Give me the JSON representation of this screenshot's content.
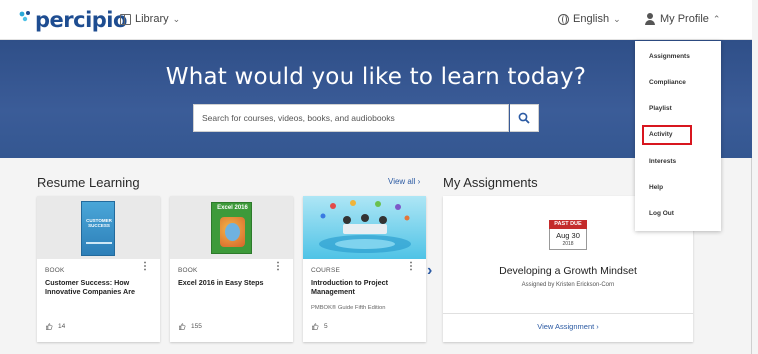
{
  "nav": {
    "logo_text": "percipio",
    "library_label": "Library",
    "language_label": "English",
    "profile_label": "My Profile",
    "chevron_down": "⌄",
    "chevron_up": "⌃"
  },
  "hero": {
    "title": "What would you like to learn today?",
    "search_placeholder": "Search for courses, videos, books, and audiobooks"
  },
  "resume": {
    "title": "Resume Learning",
    "view_all": "View all  ›",
    "cards": [
      {
        "type": "BOOK",
        "title": "Customer Success: How Innovative Companies Are",
        "subtitle": "",
        "likes": "14",
        "cover_text": "CUSTOMER SUCCESS"
      },
      {
        "type": "BOOK",
        "title": "Excel 2016 in Easy Steps",
        "subtitle": "",
        "likes": "155",
        "cover_text": "Excel 2016"
      },
      {
        "type": "COURSE",
        "title": "Introduction to Project Management",
        "subtitle": "PMBOK® Guide Fifth Edition",
        "likes": "5",
        "cover_text": ""
      }
    ],
    "next_arrow": "›"
  },
  "assignments": {
    "title": "My Assignments",
    "badge": "PAST DUE",
    "due_date": "Aug 30",
    "due_year": "2018",
    "item_title": "Developing a Growth Mindset",
    "assigned_by": "Assigned by Kristen Erickson-Corn",
    "link": "View Assignment  ›"
  },
  "profile_menu": {
    "items": [
      "Assignments",
      "Compliance",
      "Playlist",
      "Activity",
      "Interests",
      "Help",
      "Log Out"
    ],
    "highlighted": "Activity",
    "highlight_color": "#d8161f"
  },
  "colors": {
    "brand": "#1e4d91",
    "hero": "#345791",
    "link": "#2b5aa3",
    "past_due": "#c42b2b"
  }
}
